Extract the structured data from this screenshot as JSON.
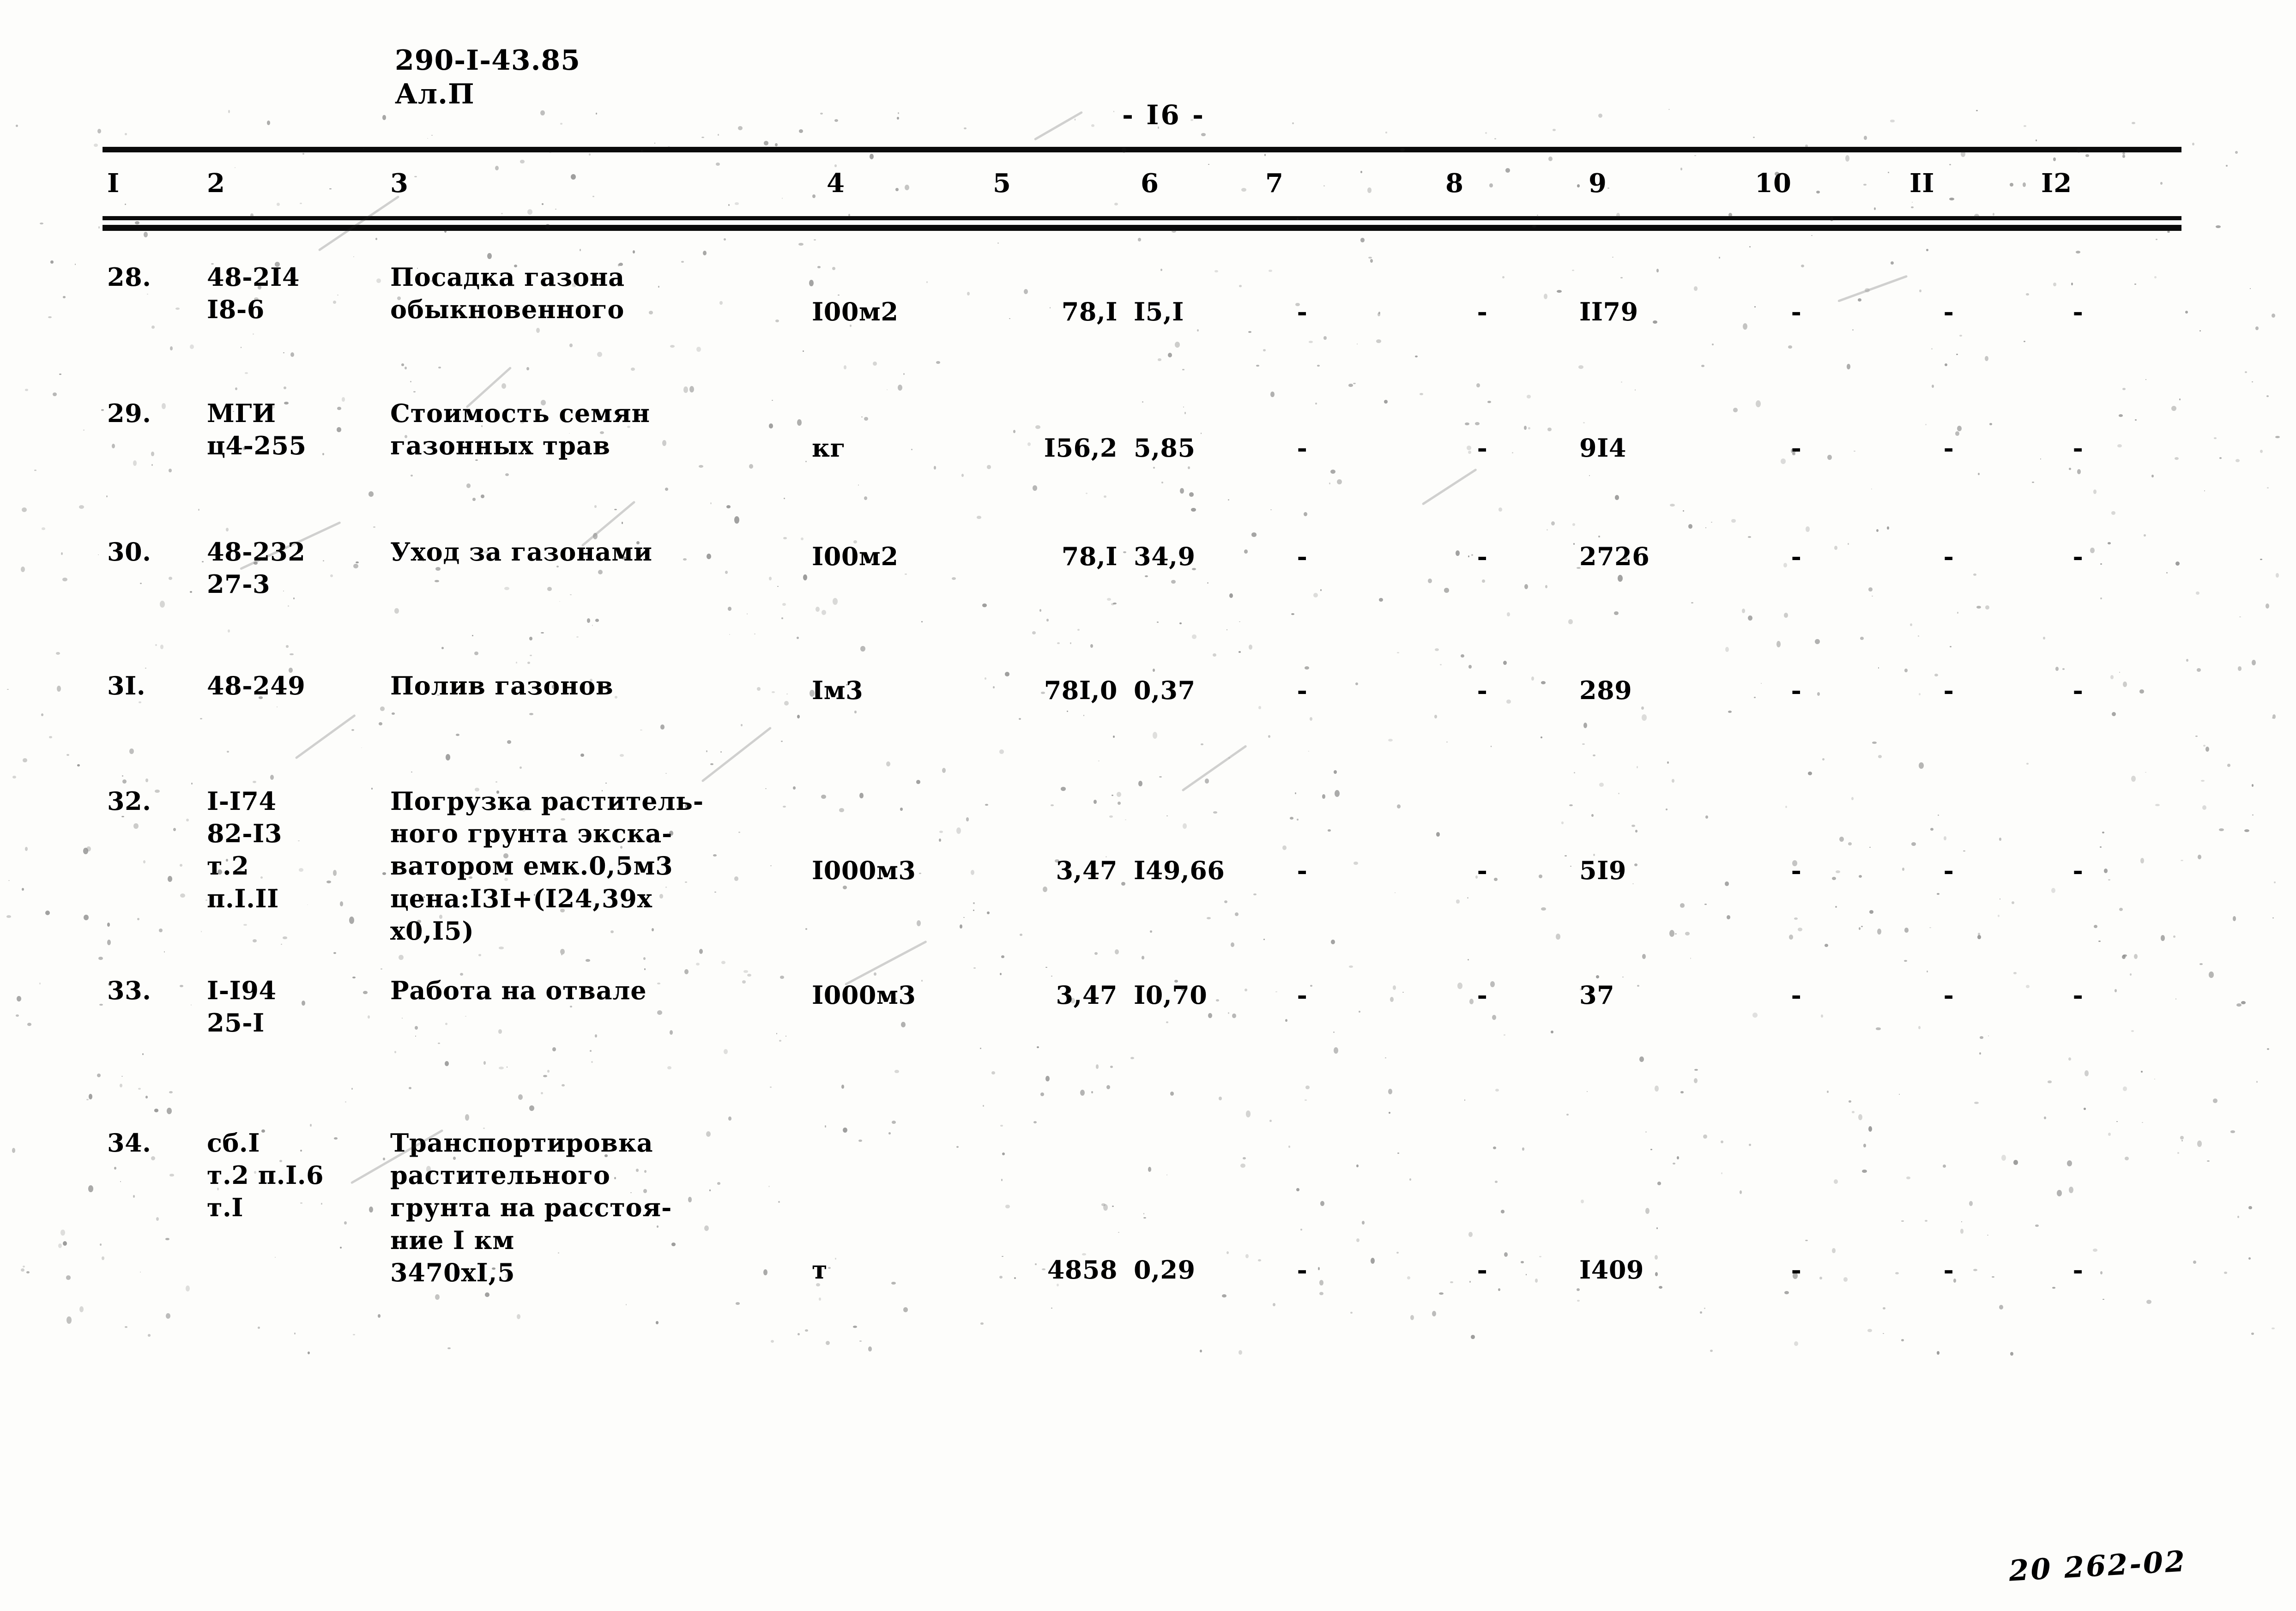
{
  "header": {
    "doc_code_line1": "290-I-43.85",
    "doc_code_line2": "Ал.П",
    "page_label": "- I6 -"
  },
  "table": {
    "column_headers": [
      "I",
      "2",
      "3",
      "4",
      "5",
      "6",
      "7",
      "8",
      "9",
      "10",
      "II",
      "I2"
    ],
    "rows": [
      {
        "no": "28.",
        "code": "48-2I4\nI8-6",
        "description": "Посадка газона\nобыкновенного",
        "unit": "I00м2",
        "qty": "78,I",
        "price": "I5,I",
        "c7": "-",
        "c8": "-",
        "c9": "II79",
        "c10": "-",
        "c11": "-",
        "c12": "-"
      },
      {
        "no": "29.",
        "code": "МГИ\nц4-255",
        "description": "Стоимость семян\nгазонных трав",
        "unit": "кг",
        "qty": "I56,2",
        "price": "5,85",
        "c7": "-",
        "c8": "-",
        "c9": "9I4",
        "c10": "-",
        "c11": "-",
        "c12": "-"
      },
      {
        "no": "30.",
        "code": "48-232\n27-3",
        "description": "Уход за газонами",
        "unit": "I00м2",
        "qty": "78,I",
        "price": "34,9",
        "c7": "-",
        "c8": "-",
        "c9": "2726",
        "c10": "-",
        "c11": "-",
        "c12": "-"
      },
      {
        "no": "3I.",
        "code": "48-249",
        "description": "Полив газонов",
        "unit": "Iм3",
        "qty": "78I,0",
        "price": "0,37",
        "c7": "-",
        "c8": "-",
        "c9": "289",
        "c10": "-",
        "c11": "-",
        "c12": "-"
      },
      {
        "no": "32.",
        "code": "I-I74\n82-I3\nт.2\nп.I.II",
        "description": "Погрузка раститель-\nного грунта экска-\nватором емк.0,5м3\nцена:I3I+(I24,39х\nх0,I5)",
        "unit": "I000м3",
        "qty": "3,47",
        "price": "I49,66",
        "c7": "-",
        "c8": "-",
        "c9": "5I9",
        "c10": "-",
        "c11": "-",
        "c12": "-"
      },
      {
        "no": "33.",
        "code": "I-I94\n25-I",
        "description": "Работа на отвале",
        "unit": "I000м3",
        "qty": "3,47",
        "price": "I0,70",
        "c7": "-",
        "c8": "-",
        "c9": "37",
        "c10": "-",
        "c11": "-",
        "c12": "-"
      },
      {
        "no": "34.",
        "code": "сб.I\nт.2 п.I.6\nт.I",
        "description": "Транспортировка\nрастительного\nгрунта на расстоя-\nние I км\n3470хI,5",
        "unit": "т",
        "qty": "4858",
        "price": "0,29",
        "c7": "-",
        "c8": "-",
        "c9": "I409",
        "c10": "-",
        "c11": "-",
        "c12": "-"
      }
    ]
  },
  "footer": {
    "archive_stamp": "20 262-02"
  }
}
